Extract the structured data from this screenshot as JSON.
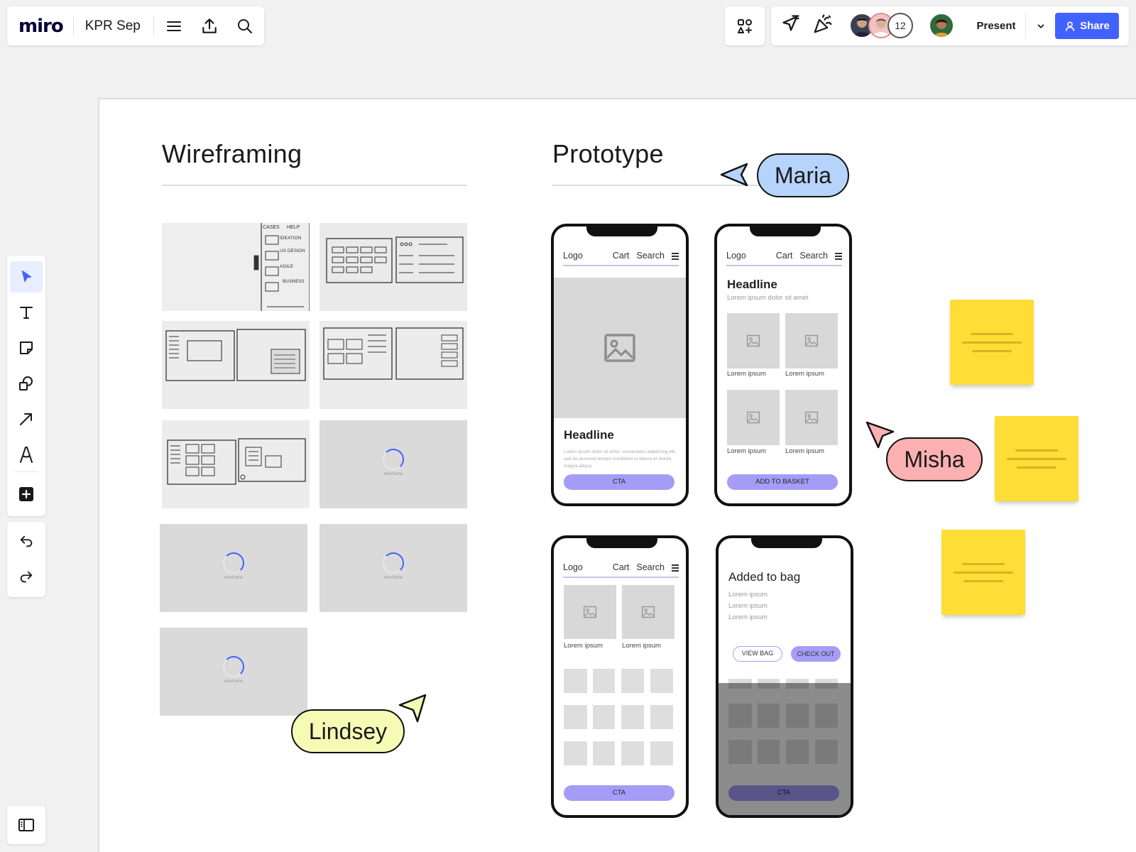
{
  "topbar": {
    "logo": "miro",
    "board_title": "KPR Sep",
    "participant_count": "12",
    "present_label": "Present",
    "share_label": "Share"
  },
  "icons": {
    "menu": "hamburger-icon",
    "export": "upload-icon",
    "search": "search-icon",
    "apps": "apps-icon",
    "cursor_toggle": "cursor-icon",
    "reactions": "party-icon",
    "dropdown": "chevron-down-icon",
    "share_user": "user-icon",
    "tools": [
      "select-icon",
      "text-icon",
      "sticky-note-icon",
      "shapes-icon",
      "arrow-icon",
      "pen-icon",
      "add-icon"
    ],
    "undo": "undo-icon",
    "redo": "redo-icon",
    "panel": "sidebar-panel-icon"
  },
  "colors": {
    "accent": "#4262ff",
    "sticky": "#fedd36",
    "maria": "#b6d3fc",
    "misha": "#fbb1b1",
    "lindsey": "#f5fbb5",
    "cta": "#a59cf7"
  },
  "board": {
    "wireframing": {
      "title": "Wireframing",
      "thumbnails": [
        {
          "state": "sketch"
        },
        {
          "state": "sketch"
        },
        {
          "state": "sketch"
        },
        {
          "state": "sketch"
        },
        {
          "state": "sketch"
        },
        {
          "state": "loading",
          "caption": "wireframe"
        },
        {
          "state": "loading",
          "caption": "wireframe"
        },
        {
          "state": "loading",
          "caption": "wireframe"
        },
        {
          "state": "loading",
          "caption": "wireframe"
        }
      ],
      "sketch_text": {
        "t1": "CASES",
        "t2": "HELP",
        "t3": "IDEATION",
        "t4": "UX DESIGN",
        "t5": "AGILE",
        "t6": "BUSINESS"
      }
    },
    "prototype": {
      "title": "Prototype",
      "phone1": {
        "nav": {
          "logo": "Logo",
          "cart": "Cart",
          "search": "Search"
        },
        "headline": "Headline",
        "body": "Lorem ipsum dolor sit amet, consectetur adipiscing elit, sed do eiusmod tempor incididunt ut labore et dolore magna aliqua.",
        "cta": "CTA"
      },
      "phone2": {
        "nav": {
          "logo": "Logo",
          "cart": "Cart",
          "search": "Search"
        },
        "headline": "Headline",
        "sub": "Lorem ipsum dolor sit amet",
        "items": [
          "Lorem ipsum",
          "Lorem ipsum",
          "Lorem ipsum",
          "Lorem ipsum"
        ],
        "cta": "ADD TO BASKET"
      },
      "phone3": {
        "nav": {
          "logo": "Logo",
          "cart": "Cart",
          "search": "Search"
        },
        "items": [
          "Lorem ipsum",
          "Lorem ipsum"
        ],
        "cta": "CTA"
      },
      "phone4": {
        "headline": "Added to bag",
        "lines": [
          "Lorem ipsum",
          "Lorem ipsum",
          "Lorem ipsum"
        ],
        "view_bag": "VIEW BAG",
        "checkout": "CHECK OUT",
        "cta": "CTA"
      }
    },
    "cursors": {
      "maria": "Maria",
      "misha": "Misha",
      "lindsey": "Lindsey"
    }
  }
}
